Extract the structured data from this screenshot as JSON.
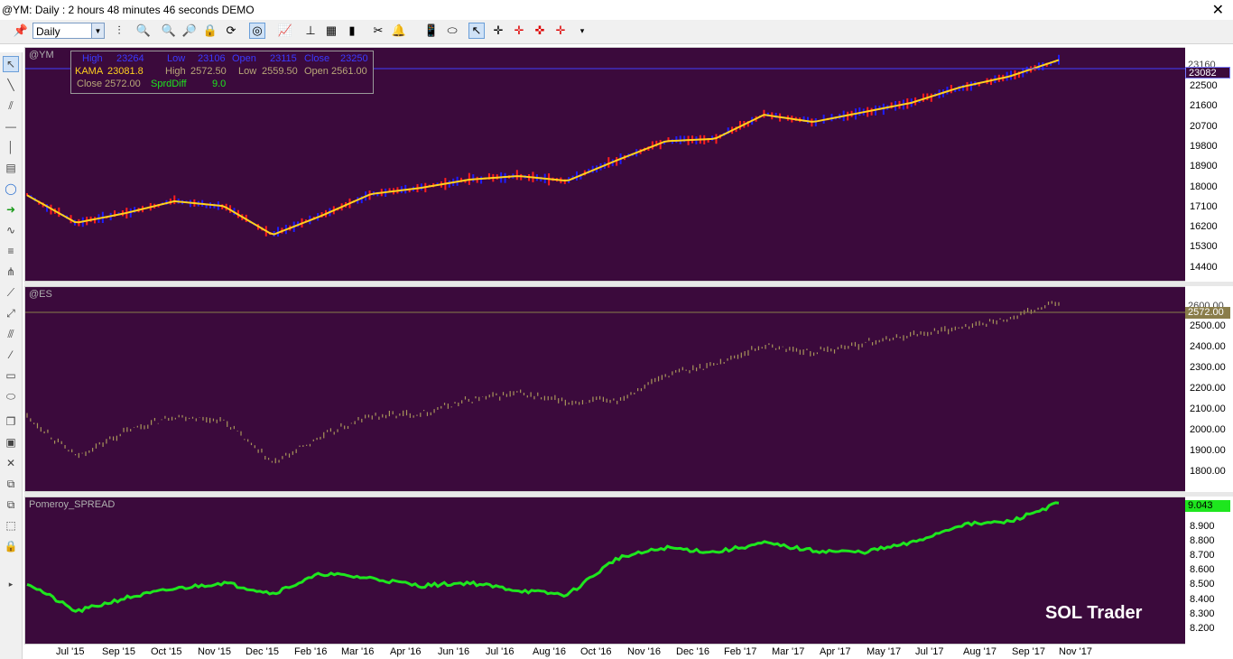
{
  "window": {
    "title": "@YM: Daily : 2 hours 48 minutes 46 seconds DEMO",
    "close_glyph": "✕"
  },
  "toolbar": {
    "period_value": "Daily",
    "icons": [
      "pin-icon",
      "bar-style-icon",
      "zoom-menu-icon",
      "zoom-in-icon",
      "zoom-out-icon",
      "lock-icon",
      "refresh-icon",
      "chart-style-icon",
      "indicator-icon",
      "hierarchy-icon",
      "template-icon",
      "bar-chart-icon",
      "scissors-icon",
      "alert-bell-icon",
      "phone-icon",
      "eraser-icon",
      "cursor-icon",
      "crosshair-icon",
      "cross-red-icon",
      "cross-dot-icon",
      "cross-flag-icon",
      "overflow-icon"
    ]
  },
  "left_tools": [
    "pointer-icon",
    "trendline-icon",
    "parallel-icon",
    "horizontal-line-icon",
    "vertical-line-icon",
    "note-icon",
    "callout-icon",
    "arrow-icon",
    "wave-icon",
    "fib-icon",
    "pitchfork-icon",
    "ray-icon",
    "regression-icon",
    "channel-icon",
    "rectangle-icon",
    "ellipse-icon",
    "stack-icon",
    "image-icon",
    "delete-icon",
    "copy-icon",
    "layers-icon",
    "select-region-icon",
    "lock-icon",
    "scroll-icon"
  ],
  "panes": {
    "ym": {
      "label": "@YM",
      "price_tag": "23082",
      "price_tag_top": "23160",
      "ticks": [
        "22500",
        "21600",
        "20700",
        "19800",
        "18900",
        "18000",
        "17100",
        "16200",
        "15300",
        "14400"
      ],
      "colors": {
        "up": "#1e1eff",
        "down": "#ff1e1e",
        "kama": "#ffd21e",
        "background": "#3b0a3c"
      }
    },
    "es": {
      "label": "@ES",
      "price_tag": "2572.00",
      "price_tag_top": "2600.00",
      "ticks": [
        "2500.00",
        "2400.00",
        "2300.00",
        "2200.00",
        "2100.00",
        "2000.00",
        "1900.00",
        "1800.00"
      ],
      "colors": {
        "bars": "#a8955a"
      }
    },
    "spread": {
      "label": "Pomeroy_SPREAD",
      "price_tag": "9.043",
      "price_tag_top": "9.000",
      "ticks": [
        "8.900",
        "8.800",
        "8.700",
        "8.600",
        "8.500",
        "8.400",
        "8.300",
        "8.200"
      ],
      "colors": {
        "line": "#1ee61e"
      }
    }
  },
  "info_box": {
    "row1": {
      "high_label": "High",
      "high": "23264",
      "low_label": "Low",
      "low": "23106",
      "open_label": "Open",
      "open": "23115",
      "close_label": "Close",
      "close": "23250"
    },
    "row2": {
      "kama_label": "KAMA",
      "kama": "23081.8",
      "high_label": "High",
      "high": "2572.50",
      "low_label": "Low",
      "low": "2559.50",
      "open_label": "Open",
      "open": "2561.00"
    },
    "row3": {
      "close_label": "Close",
      "close": "2572.00",
      "sprd_label": "SprdDiff",
      "sprd": "9.0"
    }
  },
  "x_axis": [
    "Jul '15",
    "Sep '15",
    "Oct '15",
    "Nov '15",
    "Dec '15",
    "Feb '16",
    "Mar '16",
    "Apr '16",
    "Jun '16",
    "Jul '16",
    "Aug '16",
    "Oct '16",
    "Nov '16",
    "Dec '16",
    "Feb '17",
    "Mar '17",
    "Apr '17",
    "May '17",
    "Jul '17",
    "Aug '17",
    "Sep '17",
    "Nov '17"
  ],
  "watermark": "SOL Trader",
  "chart_data": [
    {
      "type": "line",
      "title": "@YM",
      "x": [
        "Jul '15",
        "Sep '15",
        "Oct '15",
        "Nov '15",
        "Dec '15",
        "Feb '16",
        "Mar '16",
        "Apr '16",
        "Jun '16",
        "Jul '16",
        "Aug '16",
        "Oct '16",
        "Nov '16",
        "Dec '16",
        "Feb '17",
        "Mar '17",
        "Apr '17",
        "May '17",
        "Jul '17",
        "Aug '17",
        "Sep '17",
        "Nov '17"
      ],
      "series": [
        {
          "name": "KAMA",
          "values": [
            17450,
            16300,
            16700,
            17200,
            17000,
            15800,
            16600,
            17500,
            17750,
            18100,
            18250,
            18050,
            18900,
            19700,
            19800,
            20800,
            20500,
            20900,
            21300,
            21950,
            22400,
            23082
          ]
        }
      ],
      "ylim": [
        14000,
        23400
      ]
    },
    {
      "type": "line",
      "title": "@ES",
      "x": [
        "Jul '15",
        "Sep '15",
        "Oct '15",
        "Nov '15",
        "Dec '15",
        "Feb '16",
        "Mar '16",
        "Apr '16",
        "Jun '16",
        "Jul '16",
        "Aug '16",
        "Oct '16",
        "Nov '16",
        "Dec '16",
        "Feb '17",
        "Mar '17",
        "Apr '17",
        "May '17",
        "Jul '17",
        "Aug '17",
        "Sep '17",
        "Nov '17"
      ],
      "series": [
        {
          "values": [
            2070,
            1890,
            2000,
            2070,
            2050,
            1860,
            1980,
            2070,
            2080,
            2140,
            2170,
            2130,
            2140,
            2250,
            2300,
            2380,
            2350,
            2390,
            2430,
            2460,
            2500,
            2572
          ]
        }
      ],
      "ylim": [
        1750,
        2620
      ]
    },
    {
      "type": "line",
      "title": "Pomeroy_SPREAD",
      "x": [
        "Jul '15",
        "Sep '15",
        "Oct '15",
        "Nov '15",
        "Dec '15",
        "Feb '16",
        "Mar '16",
        "Apr '16",
        "Jun '16",
        "Jul '16",
        "Aug '16",
        "Oct '16",
        "Nov '16",
        "Dec '16",
        "Feb '17",
        "Mar '17",
        "Apr '17",
        "May '17",
        "Jul '17",
        "Aug '17",
        "Sep '17",
        "Nov '17"
      ],
      "series": [
        {
          "values": [
            8.52,
            8.33,
            8.42,
            8.48,
            8.52,
            8.45,
            8.58,
            8.55,
            8.5,
            8.52,
            8.47,
            8.44,
            8.68,
            8.75,
            8.72,
            8.78,
            8.73,
            8.72,
            8.78,
            8.9,
            8.92,
            9.043
          ]
        }
      ],
      "ylim": [
        8.15,
        9.05
      ]
    }
  ]
}
